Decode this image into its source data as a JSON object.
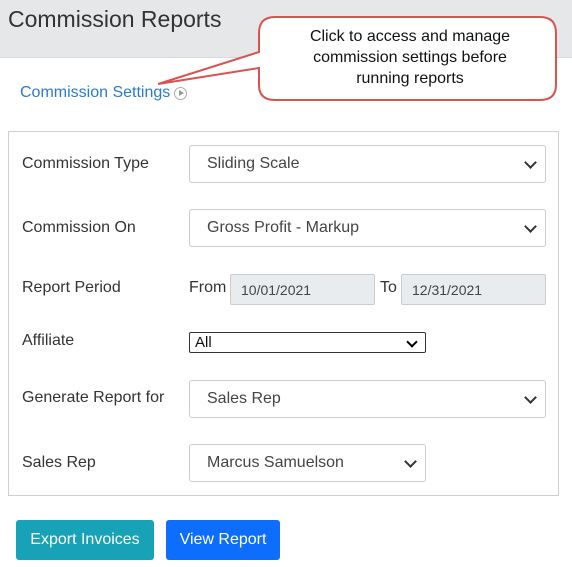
{
  "header": {
    "title": "Commission Reports"
  },
  "settings_link": {
    "label": "Commission Settings"
  },
  "callout": {
    "lines": [
      "Click to access and manage",
      "commission settings before",
      "running reports"
    ],
    "color": "#d9534f"
  },
  "form": {
    "commission_type": {
      "label": "Commission Type",
      "value": "Sliding Scale"
    },
    "commission_on": {
      "label": "Commission On",
      "value": "Gross Profit - Markup"
    },
    "report_period": {
      "label": "Report Period",
      "from_label": "From",
      "from_value": "10/01/2021",
      "to_label": "To",
      "to_value": "12/31/2021"
    },
    "affiliate": {
      "label": "Affiliate",
      "value": "All"
    },
    "generate_for": {
      "label": "Generate Report for",
      "value": "Sales Rep"
    },
    "sales_rep": {
      "label": "Sales Rep",
      "value": "Marcus Samuelson"
    }
  },
  "buttons": {
    "export": {
      "label": "Export Invoices",
      "color": "#17a2b8"
    },
    "view": {
      "label": "View Report",
      "color": "#0d6efd"
    }
  }
}
